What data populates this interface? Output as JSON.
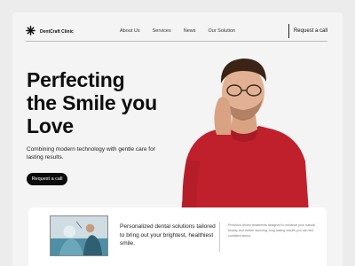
{
  "nav": {
    "brand": "DentCraft Clinic",
    "items": [
      "About Us",
      "Services",
      "News",
      "Our Solution"
    ],
    "cta": "Request a call"
  },
  "hero": {
    "title_lines": [
      "Perfecting",
      "the Smile you",
      "Love"
    ],
    "subtitle": "Combining modern technology with gentle care for lasting results.",
    "cta": "Request a call"
  },
  "card": {
    "title": "Personalized dental solutions tailored to bring out your brightest, healthiest smile.",
    "description": "Precision-driven treatments designed to enhance your natural beauty and deliver stunning, long-lasting results you can feel confident about."
  },
  "colors": {
    "background": "#ececec",
    "accent": "#0b0b0b",
    "shirt": "#c0202c"
  }
}
